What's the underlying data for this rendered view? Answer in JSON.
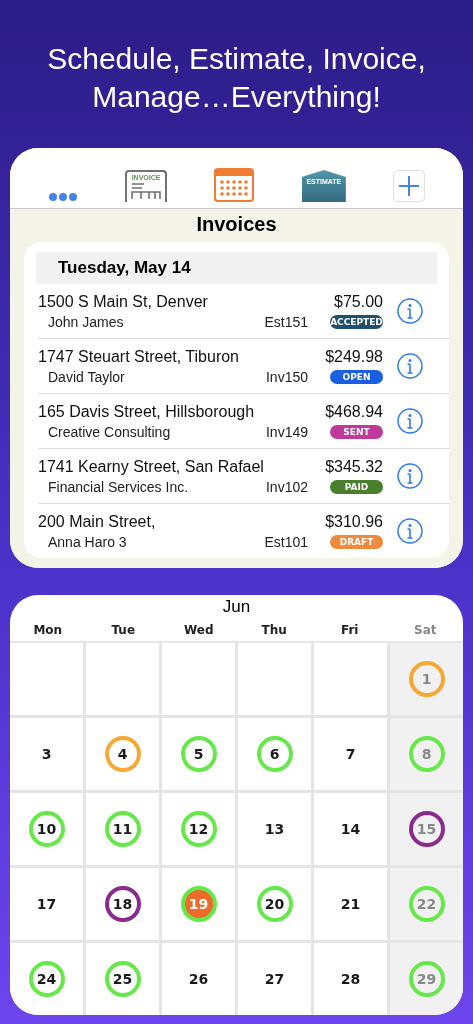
{
  "headline": "Schedule, Estimate, Invoice, Manage…Everything!",
  "toolbar": [
    {
      "kind": "more",
      "selected": false
    },
    {
      "kind": "invoice",
      "label": "INVOICE",
      "selected": false
    },
    {
      "kind": "calendar",
      "selected": true
    },
    {
      "kind": "estimate",
      "label": "ESTIMATE",
      "selected": false
    },
    {
      "kind": "add",
      "selected": false
    }
  ],
  "list_title": "Invoices",
  "section_header": "Tuesday, May 14",
  "rows": [
    {
      "address": "1500 S Main St, Denver",
      "client": "John James",
      "number": "Est151",
      "amount": "$75.00",
      "status": "ACCEPTED",
      "color": "#1f4e6e"
    },
    {
      "address": "1747 Steuart Street, Tiburon",
      "client": "David Taylor",
      "number": "Inv150",
      "amount": "$249.98",
      "status": "OPEN",
      "color": "#1a5fe0"
    },
    {
      "address": "165 Davis Street, Hillsborough",
      "client": "Creative Consulting",
      "number": "Inv149",
      "amount": "$468.94",
      "status": "SENT",
      "color": "#c0399a"
    },
    {
      "address": "1741 Kearny Street, San Rafael",
      "client": "Financial Services Inc.",
      "number": "Inv102",
      "amount": "$345.32",
      "status": "PAID",
      "color": "#4a7f2e"
    },
    {
      "address": "200 Main Street,",
      "client": "Anna Haro 3",
      "number": "Est101",
      "amount": "$310.96",
      "status": "DRAFT",
      "color": "#f08a3c"
    }
  ],
  "calendar": {
    "month": "Jun",
    "weekdays": [
      {
        "label": "Mon",
        "weekend": false
      },
      {
        "label": "Tue",
        "weekend": false
      },
      {
        "label": "Wed",
        "weekend": false
      },
      {
        "label": "Thu",
        "weekend": false
      },
      {
        "label": "Fri",
        "weekend": false
      },
      {
        "label": "Sat",
        "weekend": true
      }
    ],
    "weeks": [
      [
        {
          "kind": "empty"
        },
        {
          "kind": "empty"
        },
        {
          "kind": "empty"
        },
        {
          "kind": "empty"
        },
        {
          "kind": "empty"
        },
        {
          "kind": "day",
          "day": "1",
          "weekend": true,
          "selected": false,
          "color": "#f5a833"
        }
      ],
      [
        {
          "kind": "day",
          "day": "3",
          "weekend": false,
          "selected": false
        },
        {
          "kind": "day",
          "day": "4",
          "weekend": false,
          "selected": false,
          "color": "#f5a833"
        },
        {
          "kind": "day",
          "day": "5",
          "weekend": false,
          "selected": false,
          "color": "#66e84a"
        },
        {
          "kind": "day",
          "day": "6",
          "weekend": false,
          "selected": false,
          "color": "#66e84a"
        },
        {
          "kind": "day",
          "day": "7",
          "weekend": false,
          "selected": false
        },
        {
          "kind": "day",
          "day": "8",
          "weekend": true,
          "selected": false,
          "color": "#66e84a"
        }
      ],
      [
        {
          "kind": "day",
          "day": "10",
          "weekend": false,
          "selected": false,
          "color": "#66e84a"
        },
        {
          "kind": "day",
          "day": "11",
          "weekend": false,
          "selected": false,
          "color": "#66e84a"
        },
        {
          "kind": "day",
          "day": "12",
          "weekend": false,
          "selected": false,
          "color": "#66e84a"
        },
        {
          "kind": "day",
          "day": "13",
          "weekend": false,
          "selected": false
        },
        {
          "kind": "day",
          "day": "14",
          "weekend": false,
          "selected": false
        },
        {
          "kind": "day",
          "day": "15",
          "weekend": true,
          "selected": false,
          "color": "#8a2a8e"
        }
      ],
      [
        {
          "kind": "day",
          "day": "17",
          "weekend": false,
          "selected": false
        },
        {
          "kind": "day",
          "day": "18",
          "weekend": false,
          "selected": false,
          "color": "#8a2a8e"
        },
        {
          "kind": "day",
          "day": "19",
          "weekend": false,
          "selected": true,
          "color": "#66e84a"
        },
        {
          "kind": "day",
          "day": "20",
          "weekend": false,
          "selected": false,
          "color": "#66e84a"
        },
        {
          "kind": "day",
          "day": "21",
          "weekend": false,
          "selected": false
        },
        {
          "kind": "day",
          "day": "22",
          "weekend": true,
          "selected": false,
          "color": "#66e84a"
        }
      ],
      [
        {
          "kind": "day",
          "day": "24",
          "weekend": false,
          "selected": false,
          "color": "#66e84a"
        },
        {
          "kind": "day",
          "day": "25",
          "weekend": false,
          "selected": false,
          "color": "#66e84a"
        },
        {
          "kind": "day",
          "day": "26",
          "weekend": false,
          "selected": false
        },
        {
          "kind": "day",
          "day": "27",
          "weekend": false,
          "selected": false
        },
        {
          "kind": "day",
          "day": "28",
          "weekend": false,
          "selected": false
        },
        {
          "kind": "day",
          "day": "29",
          "weekend": true,
          "selected": false,
          "color": "#66e84a"
        }
      ]
    ]
  }
}
